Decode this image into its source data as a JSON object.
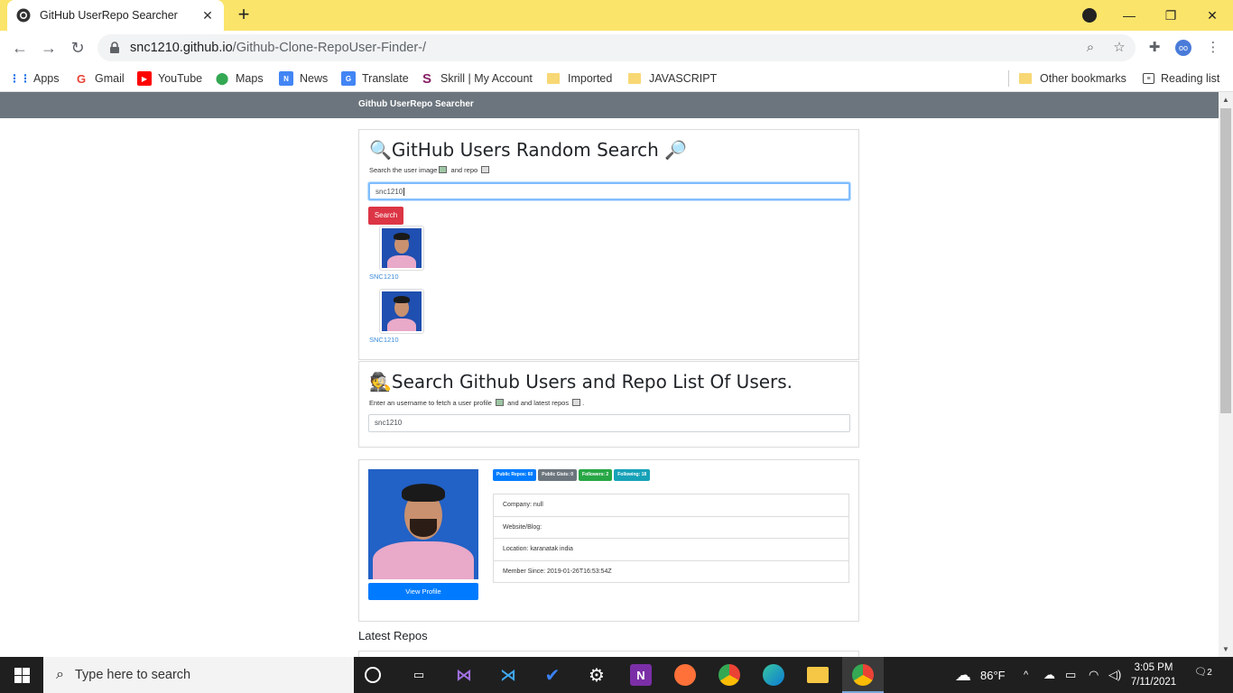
{
  "browser": {
    "tab_title": "GitHub UserRepo Searcher",
    "tab_close": "✕",
    "new_tab": "+",
    "url_host": "snc1210.github.io",
    "url_path": "/Github-Clone-RepoUser-Finder-/",
    "bookmarks": [
      "Apps",
      "Gmail",
      "YouTube",
      "Maps",
      "News",
      "Translate",
      "Skrill | My Account",
      "Imported",
      "JAVASCRIPT",
      "Other bookmarks",
      "Reading list"
    ]
  },
  "page": {
    "navbar_brand": "Github UserRepo Searcher",
    "random_search": {
      "title": "GitHub Users Random Search",
      "subtitle_pre": "Search the user image",
      "subtitle_mid": " and repo ",
      "input_value": "snc1210",
      "search_button": "Search",
      "results": [
        {
          "login": "SNC1210"
        },
        {
          "login": "SNC1210"
        }
      ]
    },
    "repo_search": {
      "title": "Search Github Users and Repo List Of Users.",
      "subtitle_pre": "Enter an username to fetch a user profile",
      "subtitle_mid": " and and latest repos ",
      "subtitle_end": ".",
      "input_value": "snc1210"
    },
    "profile": {
      "view_profile_button": "View Profile",
      "badges": [
        {
          "label": "Public Repos: 60",
          "color": "#007bff"
        },
        {
          "label": "Public Gists: 0",
          "color": "#6c757d"
        },
        {
          "label": "Followers: 2",
          "color": "#28a745"
        },
        {
          "label": "Following: 18",
          "color": "#17a2b8"
        }
      ],
      "details": [
        "Company: null",
        "Website/Blog:",
        "Location: karanatak india",
        "Member Since: 2019-01-26T16:53:54Z"
      ]
    },
    "latest_repos_title": "Latest Repos"
  },
  "taskbar": {
    "search_placeholder": "Type here to search",
    "weather": "86°F",
    "time": "3:05 PM",
    "date": "7/11/2021",
    "notifications": "2"
  }
}
